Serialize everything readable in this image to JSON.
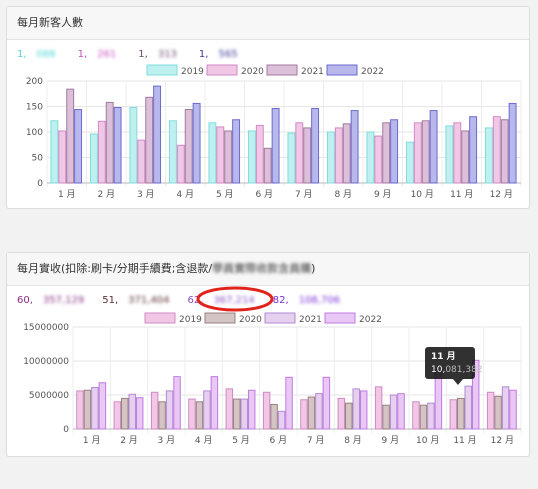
{
  "panels": {
    "new_customers": {
      "title": "每月新客人數",
      "totals": [
        {
          "year": "2019",
          "prefix": "1,",
          "blur": "088",
          "color": "#4fd6d6"
        },
        {
          "year": "2020",
          "prefix": "1,",
          "blur": "261",
          "color": "#c64dbf"
        },
        {
          "year": "2021",
          "prefix": "1,",
          "blur": "313",
          "color": "#6b4a6b"
        },
        {
          "year": "2022",
          "prefix": "1,",
          "blur": "565",
          "color": "#3d3d9e"
        }
      ]
    },
    "revenue": {
      "title_prefix": "每月實收(扣除:刷卡/分期手續費;含退款/",
      "title_blur": "學員實際收款含員購",
      "title_suffix": ")",
      "totals": [
        {
          "year": "2019",
          "prefix": "60,",
          "blur": "357,129",
          "color": "#8b2f86"
        },
        {
          "year": "2020",
          "prefix": "51,",
          "blur": "371,404",
          "color": "#5a3030"
        },
        {
          "year": "2021",
          "prefix": "62,",
          "blur": "367,214",
          "color": "#8b4fc4"
        },
        {
          "year": "2022",
          "prefix": "82,",
          "blur": "108,706",
          "color": "#7a2fd6"
        }
      ]
    }
  },
  "chart_data": [
    {
      "type": "bar",
      "categories": [
        "1 月",
        "2 月",
        "3 月",
        "4 月",
        "5 月",
        "6 月",
        "7 月",
        "8 月",
        "9 月",
        "10 月",
        "11 月",
        "12 月"
      ],
      "ylim": [
        0,
        200
      ],
      "yticks": [
        "0",
        "50",
        "100",
        "150",
        "200"
      ],
      "series": [
        {
          "name": "2019",
          "color": "#bff0f0",
          "stroke": "#7fdcdc",
          "values": [
            122,
            96,
            148,
            122,
            118,
            102,
            98,
            100,
            100,
            80,
            112,
            108
          ]
        },
        {
          "name": "2020",
          "color": "#f0c8e6",
          "stroke": "#d288c6",
          "values": [
            102,
            121,
            84,
            74,
            110,
            113,
            118,
            108,
            92,
            118,
            118,
            130
          ]
        },
        {
          "name": "2021",
          "color": "#dcbfd9",
          "stroke": "#a07a9c",
          "values": [
            184,
            158,
            168,
            144,
            102,
            68,
            108,
            116,
            118,
            122,
            102,
            124
          ]
        },
        {
          "name": "2022",
          "color": "#b8b8ec",
          "stroke": "#6a6ad0",
          "values": [
            144,
            148,
            190,
            156,
            124,
            146,
            146,
            142,
            124,
            142,
            130,
            156
          ]
        }
      ]
    },
    {
      "type": "bar",
      "categories": [
        "1 月",
        "2 月",
        "3 月",
        "4 月",
        "5 月",
        "6 月",
        "7 月",
        "8 月",
        "9 月",
        "10 月",
        "11 月",
        "12 月"
      ],
      "ylim": [
        0,
        15000000
      ],
      "yticks": [
        "0",
        "5000000",
        "10000000",
        "15000000"
      ],
      "series": [
        {
          "name": "2019",
          "color": "#f0c8e6",
          "stroke": "#d288c6",
          "values": [
            5600000,
            4000000,
            5400000,
            4400000,
            5900000,
            5400000,
            4300000,
            4500000,
            6200000,
            4000000,
            4300000,
            5400000
          ]
        },
        {
          "name": "2020",
          "color": "#d4c4c4",
          "stroke": "#9a8080",
          "values": [
            5700000,
            4500000,
            4000000,
            4000000,
            4400000,
            3600000,
            4700000,
            3800000,
            3500000,
            3500000,
            4500000,
            4800000
          ]
        },
        {
          "name": "2021",
          "color": "#e6d0f0",
          "stroke": "#b28ad0",
          "values": [
            6100000,
            5100000,
            5600000,
            5600000,
            4400000,
            2600000,
            5200000,
            5900000,
            5000000,
            3800000,
            6300000,
            6200000
          ]
        },
        {
          "name": "2022",
          "color": "#eac8f6",
          "stroke": "#c07ae0",
          "values": [
            6800000,
            4600000,
            7700000,
            7700000,
            5700000,
            7600000,
            7600000,
            5600000,
            5200000,
            8700000,
            10100000,
            5700000
          ]
        }
      ],
      "tooltip": {
        "title": "11 月",
        "value_prefix": "10,",
        "value_blur": "081,382"
      }
    }
  ]
}
